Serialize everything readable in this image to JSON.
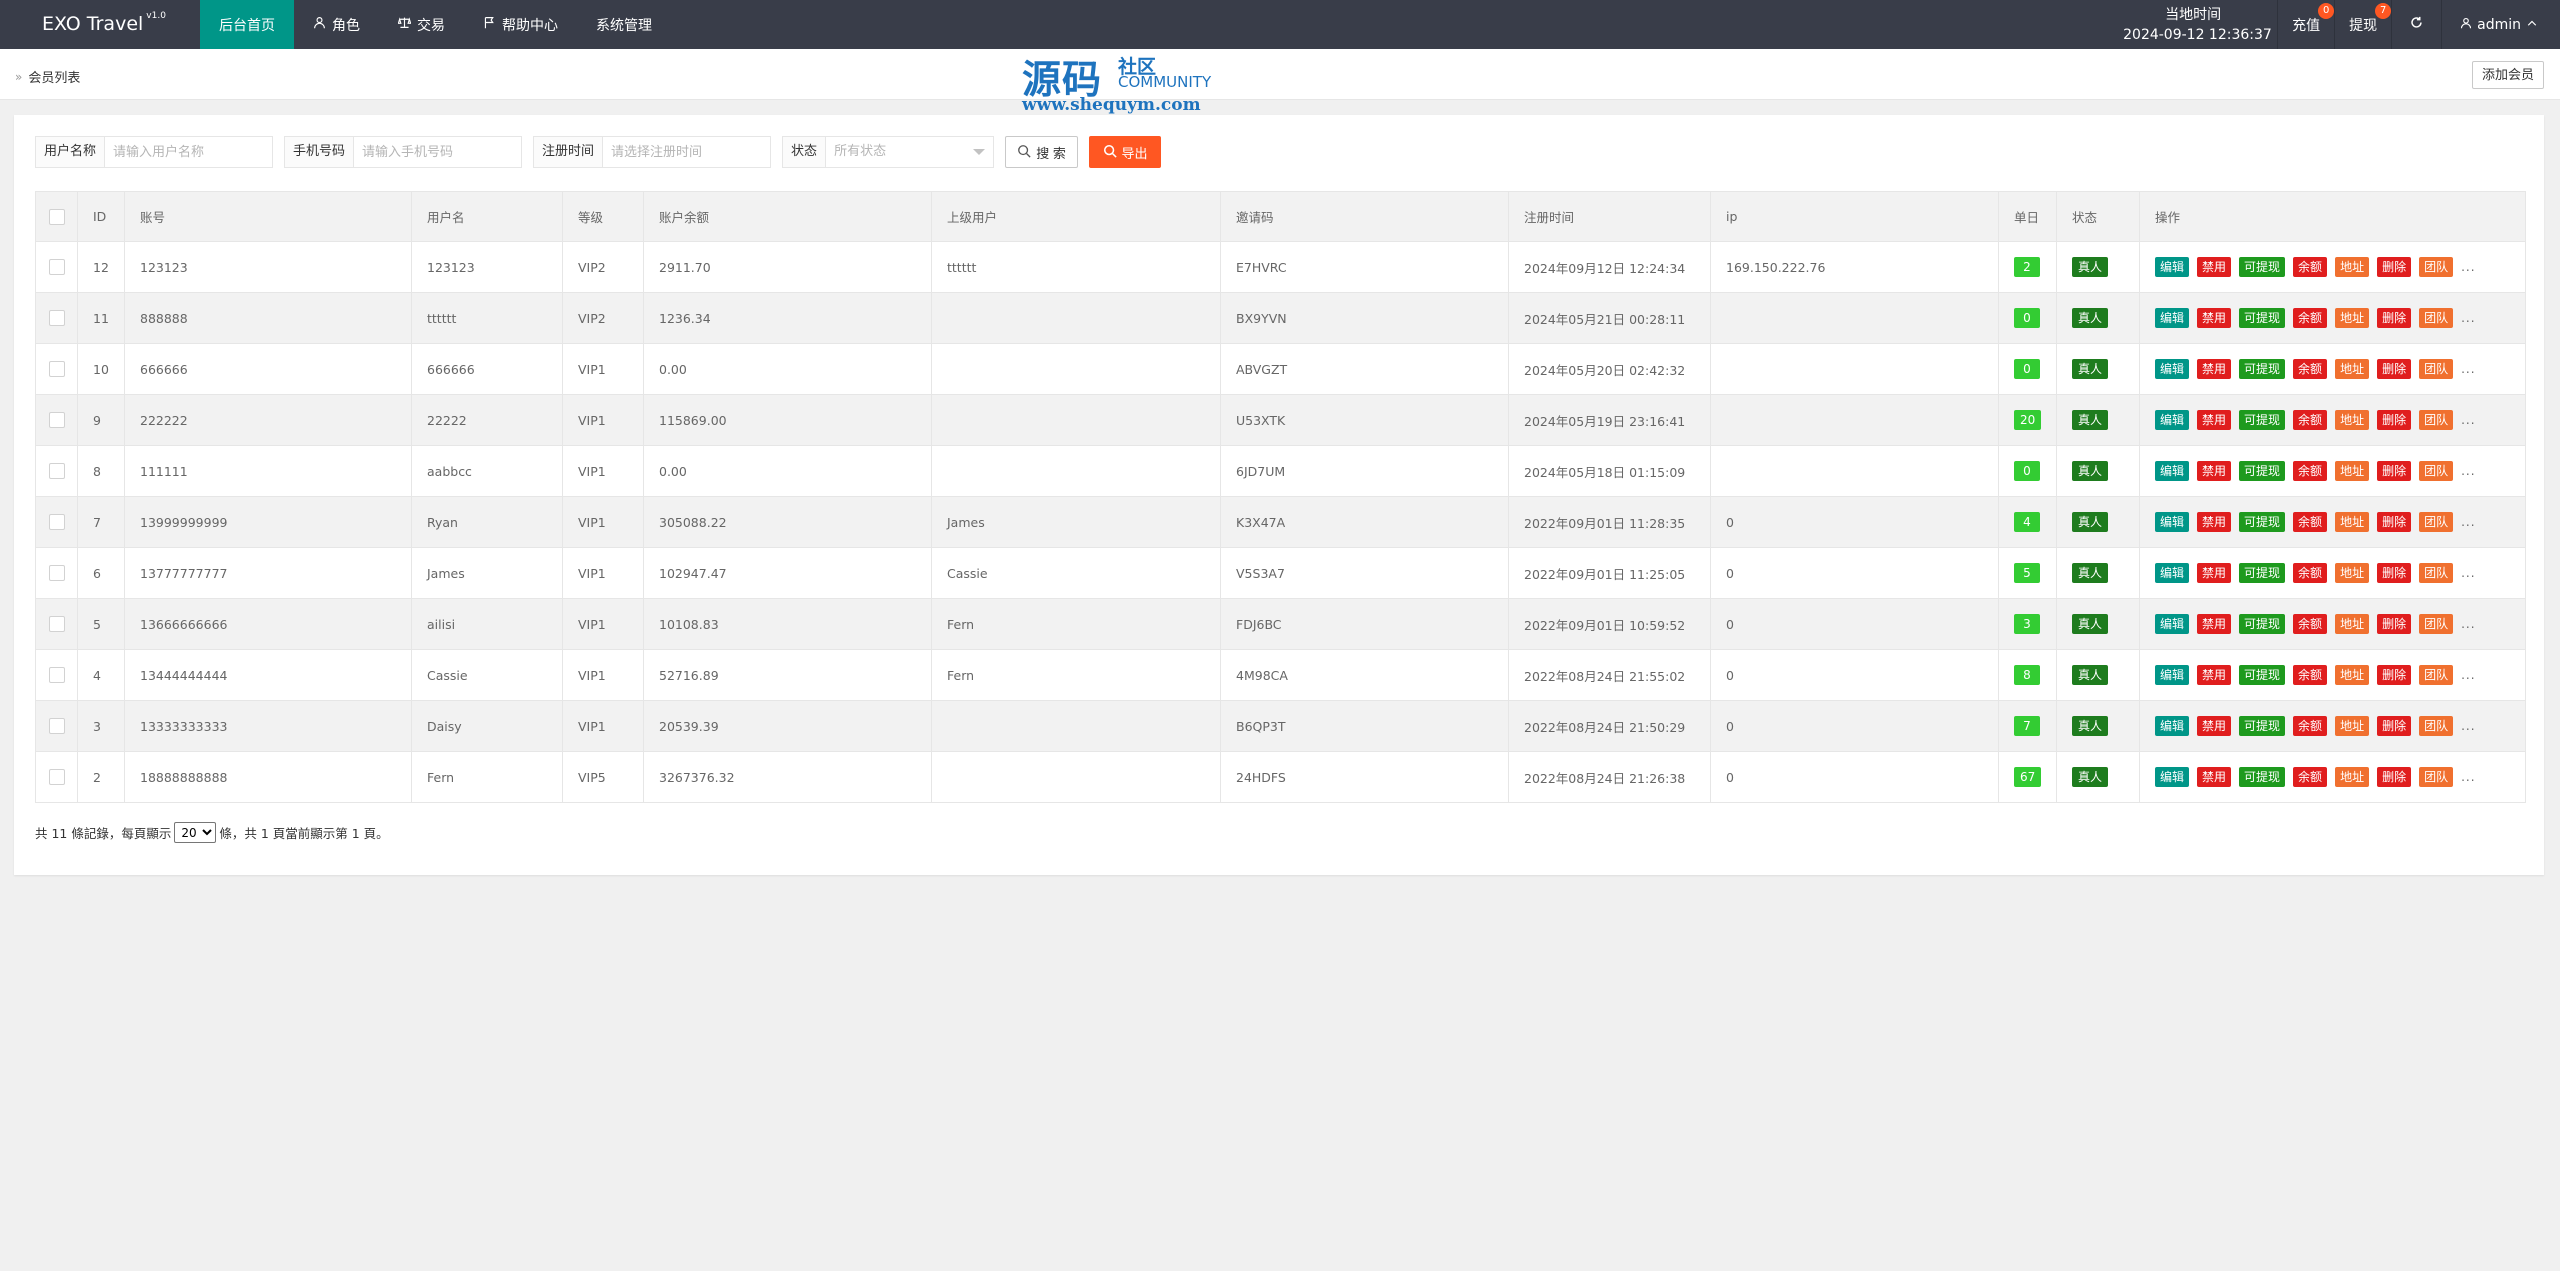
{
  "app": {
    "name": "EXO Travel",
    "version": "v1.0"
  },
  "nav": [
    {
      "label": "后台首页",
      "icon": "",
      "active": true
    },
    {
      "label": "角色",
      "icon": "user-icon",
      "active": false
    },
    {
      "label": "交易",
      "icon": "scale-icon",
      "active": false
    },
    {
      "label": "帮助中心",
      "icon": "flag-icon",
      "active": false
    },
    {
      "label": "系统管理",
      "icon": "",
      "active": false
    }
  ],
  "header": {
    "clock_label": "当地时间",
    "clock_value": "2024-09-12 12:36:37",
    "recharge_label": "充值",
    "recharge_badge": "0",
    "withdraw_label": "提现",
    "withdraw_badge": "7",
    "user_label": "admin"
  },
  "breadcrumb": {
    "current": "会员列表"
  },
  "add_button": "添加会员",
  "watermark": {
    "big": "源码",
    "cn": "社区",
    "en": "COMMUNITY",
    "url": "www.shequym.com"
  },
  "filters": {
    "username_label": "用户名称",
    "username_placeholder": "请输入用户名称",
    "phone_label": "手机号码",
    "phone_placeholder": "请输入手机号码",
    "regtime_label": "注册时间",
    "regtime_placeholder": "请选择注册时间",
    "status_label": "状态",
    "status_value": "所有状态",
    "search_button": "搜 索",
    "export_button": "导出"
  },
  "table": {
    "headers": [
      "ID",
      "账号",
      "用户名",
      "等级",
      "账户余额",
      "上级用户",
      "邀请码",
      "注册时间",
      "ip",
      "单日",
      "状态",
      "操作"
    ],
    "op_labels": [
      "编辑",
      "禁用",
      "可提现",
      "余额",
      "地址",
      "删除",
      "团队"
    ],
    "more": "...",
    "rows": [
      {
        "id": "12",
        "account": "123123",
        "username": "123123",
        "level": "VIP2",
        "balance": "2911.70",
        "parent": "tttttt",
        "invite": "E7HVRC",
        "regtime": "2024年09月12日 12:24:34",
        "ip": "169.150.222.76",
        "daily": "2",
        "status": "真人"
      },
      {
        "id": "11",
        "account": "888888",
        "username": "tttttt",
        "level": "VIP2",
        "balance": "1236.34",
        "parent": "",
        "invite": "BX9YVN",
        "regtime": "2024年05月21日 00:28:11",
        "ip": "",
        "daily": "0",
        "status": "真人"
      },
      {
        "id": "10",
        "account": "666666",
        "username": "666666",
        "level": "VIP1",
        "balance": "0.00",
        "parent": "",
        "invite": "ABVGZT",
        "regtime": "2024年05月20日 02:42:32",
        "ip": "",
        "daily": "0",
        "status": "真人"
      },
      {
        "id": "9",
        "account": "222222",
        "username": "22222",
        "level": "VIP1",
        "balance": "115869.00",
        "parent": "",
        "invite": "U53XTK",
        "regtime": "2024年05月19日 23:16:41",
        "ip": "",
        "daily": "20",
        "status": "真人"
      },
      {
        "id": "8",
        "account": "111111",
        "username": "aabbcc",
        "level": "VIP1",
        "balance": "0.00",
        "parent": "",
        "invite": "6JD7UM",
        "regtime": "2024年05月18日 01:15:09",
        "ip": "",
        "daily": "0",
        "status": "真人"
      },
      {
        "id": "7",
        "account": "13999999999",
        "username": "Ryan",
        "level": "VIP1",
        "balance": "305088.22",
        "parent": "James",
        "invite": "K3X47A",
        "regtime": "2022年09月01日 11:28:35",
        "ip": "0",
        "daily": "4",
        "status": "真人"
      },
      {
        "id": "6",
        "account": "13777777777",
        "username": "James",
        "level": "VIP1",
        "balance": "102947.47",
        "parent": "Cassie",
        "invite": "V5S3A7",
        "regtime": "2022年09月01日 11:25:05",
        "ip": "0",
        "daily": "5",
        "status": "真人"
      },
      {
        "id": "5",
        "account": "13666666666",
        "username": "ailisi",
        "level": "VIP1",
        "balance": "10108.83",
        "parent": "Fern",
        "invite": "FDJ6BC",
        "regtime": "2022年09月01日 10:59:52",
        "ip": "0",
        "daily": "3",
        "status": "真人"
      },
      {
        "id": "4",
        "account": "13444444444",
        "username": "Cassie",
        "level": "VIP1",
        "balance": "52716.89",
        "parent": "Fern",
        "invite": "4M98CA",
        "regtime": "2022年08月24日 21:55:02",
        "ip": "0",
        "daily": "8",
        "status": "真人"
      },
      {
        "id": "3",
        "account": "13333333333",
        "username": "Daisy",
        "level": "VIP1",
        "balance": "20539.39",
        "parent": "",
        "invite": "B6QP3T",
        "regtime": "2022年08月24日 21:50:29",
        "ip": "0",
        "daily": "7",
        "status": "真人"
      },
      {
        "id": "2",
        "account": "18888888888",
        "username": "Fern",
        "level": "VIP5",
        "balance": "3267376.32",
        "parent": "",
        "invite": "24HDFS",
        "regtime": "2022年08月24日 21:26:38",
        "ip": "0",
        "daily": "67",
        "status": "真人"
      }
    ]
  },
  "pager": {
    "prefix": "共 11 條記錄，每頁顯示",
    "per_page": "20",
    "suffix": "條，共 1 頁當前顯示第 1 頁。"
  },
  "colors": {
    "topbar": "#393d49",
    "nav_active": "#009688",
    "export": "#ff5722",
    "edit": "#009688",
    "danger": "#e01e1e",
    "success": "#1e9a1e",
    "warn": "#f0702f"
  }
}
